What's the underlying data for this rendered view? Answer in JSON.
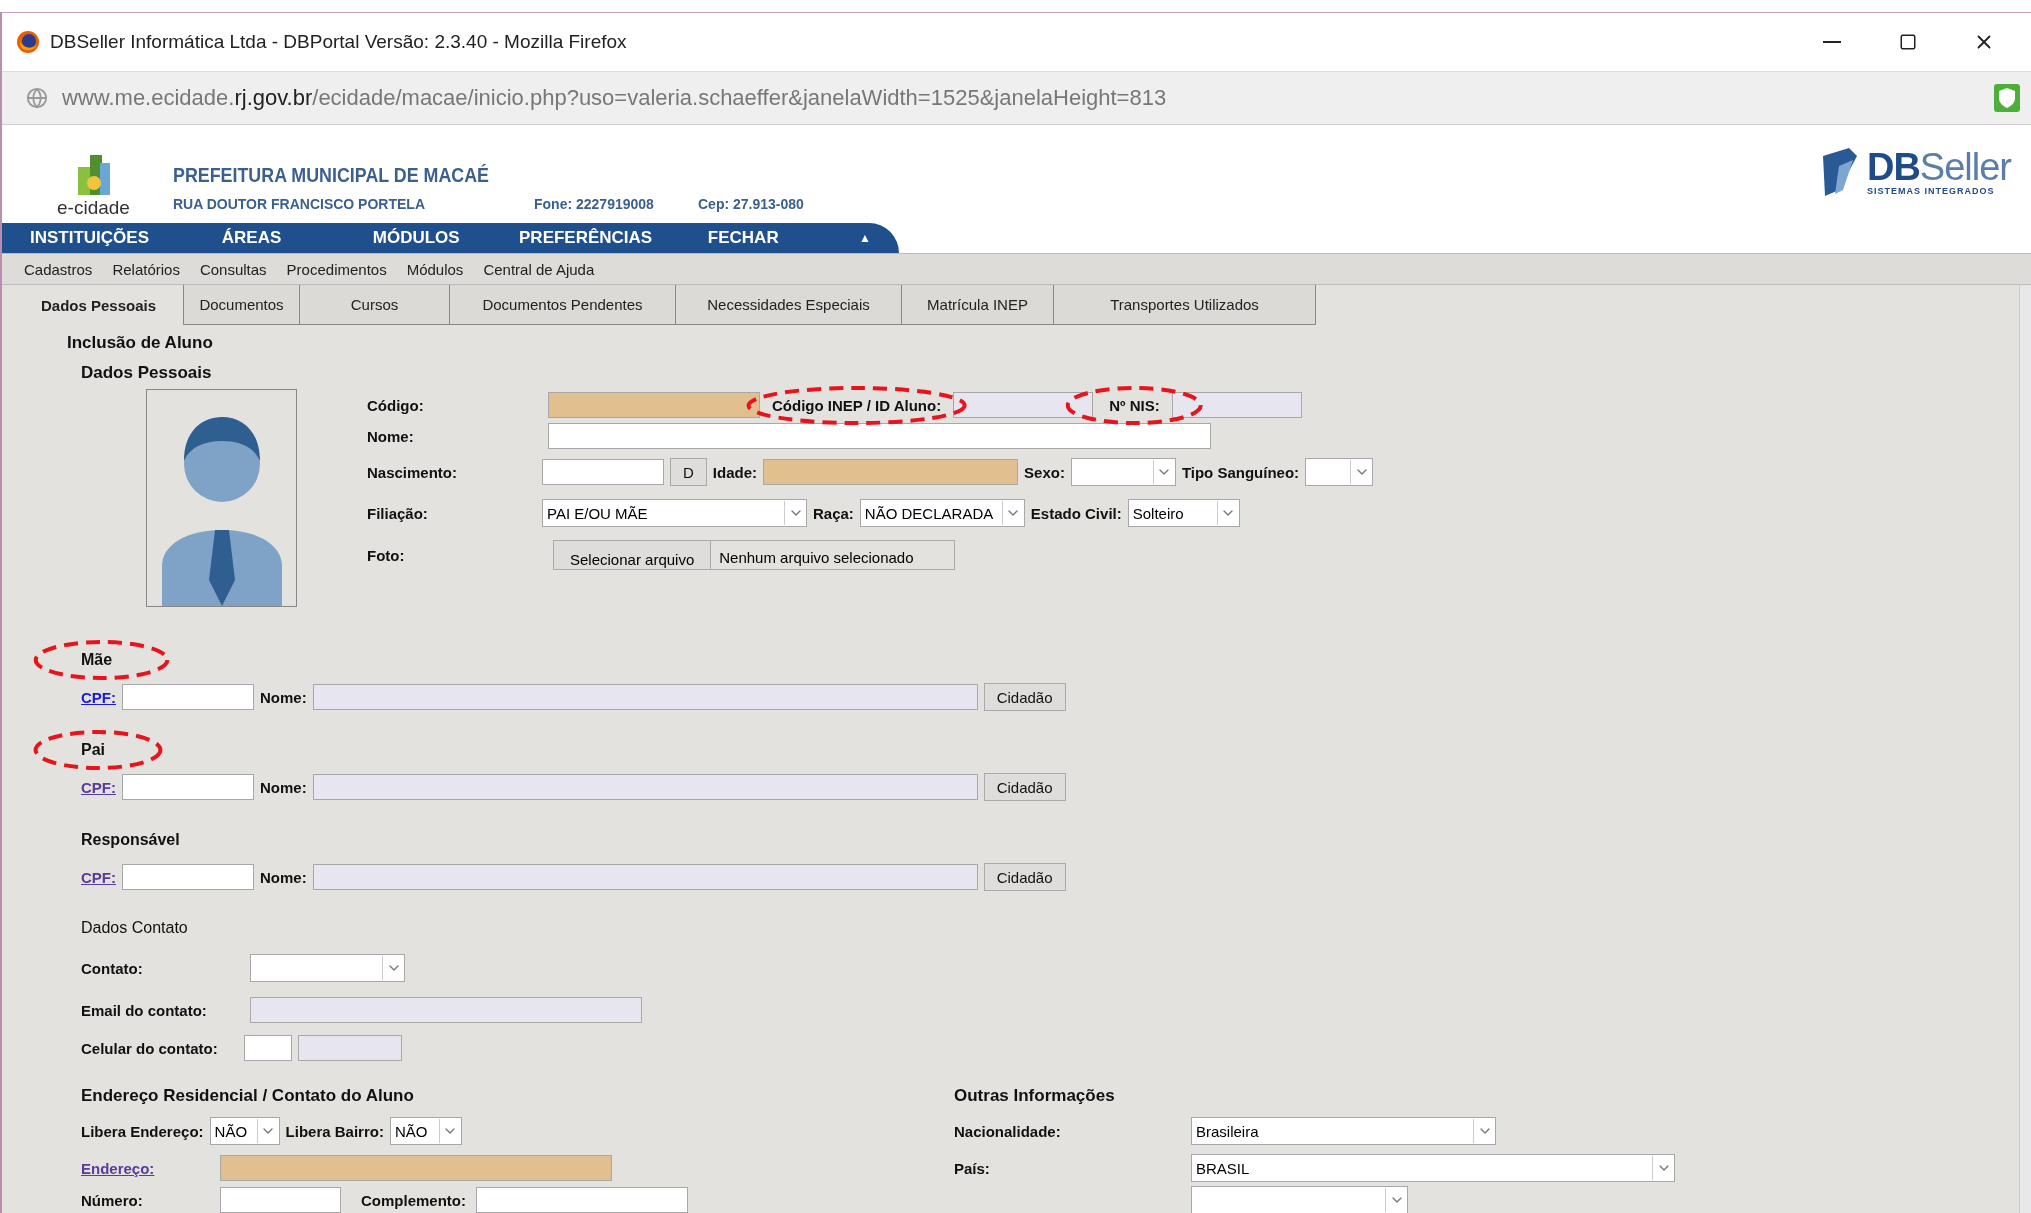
{
  "window": {
    "title": "DBSeller Informática Ltda - DBPortal Versão: 2.3.40 - Mozilla Firefox"
  },
  "address_bar": {
    "url_start": "www.me.ecidade.",
    "url_domain": "rj.gov.br",
    "url_end": "/ecidade/macae/inicio.php?uso=valeria.schaeffer&janelaWidth=1525&janelaHeight=813"
  },
  "header": {
    "logo_text": "e-cidade",
    "org_name": "PREFEITURA MUNICIPAL DE MACAÉ",
    "street": "RUA DOUTOR FRANCISCO PORTELA",
    "phone": "Fone: 2227919008",
    "cep": "Cep: 27.913-080",
    "brand": {
      "bold": "DB",
      "light": "Seller",
      "tagline": "SISTEMAS INTEGRADOS"
    }
  },
  "main_menu": {
    "items": [
      "INSTITUIÇÕES",
      "ÁREAS",
      "MÓDULOS",
      "PREFERÊNCIAS",
      "FECHAR"
    ],
    "toggle": "▲"
  },
  "sub_menu": [
    "Cadastros",
    "Relatórios",
    "Consultas",
    "Procedimentos",
    "Módulos",
    "Central de Ajuda"
  ],
  "tabs": [
    {
      "label": "Dados Pessoais",
      "selected": true
    },
    {
      "label": "Documentos",
      "selected": false
    },
    {
      "label": "Cursos",
      "selected": false
    },
    {
      "label": "Documentos Pendentes",
      "selected": false
    },
    {
      "label": "Necessidades Especiais",
      "selected": false
    },
    {
      "label": "Matrícula INEP",
      "selected": false
    },
    {
      "label": "Transportes Utilizados",
      "selected": false
    }
  ],
  "personal": {
    "title": "Inclusão de Aluno",
    "subtitle": "Dados Pessoais",
    "codigo": {
      "label": "Código:",
      "readonly": true
    },
    "inep": {
      "label": "Código INEP / ID Aluno:",
      "circled": true,
      "disabled": true
    },
    "nis": {
      "label": "Nº NIS:",
      "circled": true,
      "disabled": true
    },
    "nome": {
      "label": "Nome:",
      "readonly": false
    },
    "nascimento": {
      "label": "Nascimento:",
      "readonly": false,
      "button": "D"
    },
    "idade": {
      "label": "Idade:",
      "readonly": true
    },
    "sexo": {
      "label": "Sexo:"
    },
    "tipo_sanguineo": {
      "label": "Tipo Sanguíneo:"
    },
    "filiacao": {
      "label": "Filiação:",
      "value": "PAI E/OU MÃE"
    },
    "raca": {
      "label": "Raça:",
      "value": "NÃO DECLARADA"
    },
    "estado_civil": {
      "label": "Estado Civil:",
      "value": "Solteiro"
    },
    "foto": {
      "label": "Foto:",
      "button": "Selecionar arquivo",
      "status": "Nenhum arquivo selecionado"
    }
  },
  "relatives": [
    {
      "title": "Mãe",
      "circled": true,
      "cpf_link": "CPF:",
      "visited": false,
      "name_label": "Nome:",
      "button": "Cidadão"
    },
    {
      "title": "Pai",
      "circled": true,
      "cpf_link": "CPF:",
      "visited": true,
      "name_label": "Nome:",
      "button": "Cidadão"
    },
    {
      "title": "Responsável",
      "circled": false,
      "cpf_link": "CPF:",
      "visited": true,
      "name_label": "Nome:",
      "button": "Cidadão"
    }
  ],
  "contact": {
    "title": "Dados Contato",
    "contato_label": "Contato:",
    "email_label": "Email do contato:",
    "celular_label": "Celular do contato:"
  },
  "address": {
    "title": "Endereço Residencial / Contato do Aluno",
    "libera_endereco": {
      "label": "Libera Endereço:",
      "value": "NÃO"
    },
    "libera_bairro": {
      "label": "Libera Bairro:",
      "value": "NÃO"
    },
    "endereco_link": "Endereço:",
    "numero_label": "Número:",
    "complemento_label": "Complemento:"
  },
  "other": {
    "title": "Outras Informações",
    "nacionalidade": {
      "label": "Nacionalidade:",
      "value": "Brasileira"
    },
    "pais": {
      "label": "País:",
      "value": "BRASIL"
    }
  }
}
